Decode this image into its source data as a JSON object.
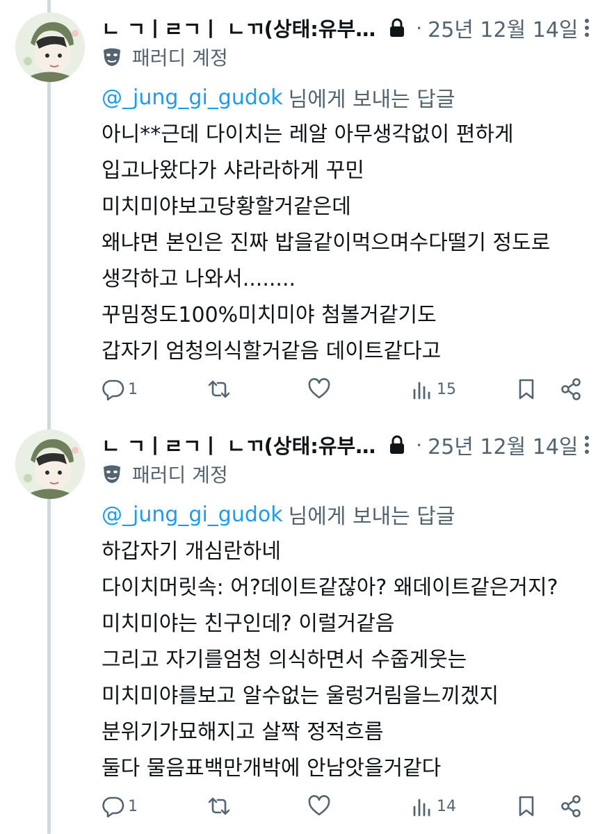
{
  "tweets": [
    {
      "display_name": "ㄴ ㄱㅣㄹㄱㅣ ㄴㄲ(상태:유부…",
      "date": "25년 12월 14일",
      "account_label": "패러디 계정",
      "reply_to": "@_jung_gi_gudok",
      "reply_suffix": "님에게 보내는 답글",
      "body": [
        "아니**근데 다이치는 레알 아무생각없이 편하게",
        "입고나왔다가 샤라라하게 꾸민",
        "미치미야보고당황할거같은데",
        "왜냐면 본인은 진짜 밥을같이먹으며수다떨기  정도로",
        "생각하고 나와서........",
        "꾸밈정도100%미치미야 첨볼거같기도",
        "갑자기 엄청의식할거같음 데이트같다고"
      ],
      "replies": "1",
      "views": "15"
    },
    {
      "display_name": "ㄴ ㄱㅣㄹㄱㅣ ㄴㄲ(상태:유부…",
      "date": "25년 12월 14일",
      "account_label": "패러디 계정",
      "reply_to": "@_jung_gi_gudok",
      "reply_suffix": "님에게 보내는 답글",
      "body": [
        "하갑자기 개심란하네",
        "다이치머릿속: 어?데이트같잖아? 왜데이트같은거지?",
        "미치미야는 친구인데? 이럴거같음",
        "그리고 자기를엄청 의식하면서 수줍게웃는",
        "미치미야를보고 알수없는  울렁거림을느끼겠지",
        "분위기가묘해지고 살짝 정적흐름",
        "둘다 물음표백만개박에 안남앗을거같다"
      ],
      "replies": "1",
      "views": "14"
    }
  ],
  "colors": {
    "text_primary": "#0f1419",
    "text_secondary": "#536471",
    "mention": "#1d9bf0",
    "thread_line": "#cfd9de"
  },
  "icons": [
    "lock-icon",
    "more-icon",
    "parody-mask-icon",
    "reply-icon",
    "retweet-icon",
    "like-icon",
    "views-icon",
    "bookmark-icon",
    "share-icon"
  ]
}
